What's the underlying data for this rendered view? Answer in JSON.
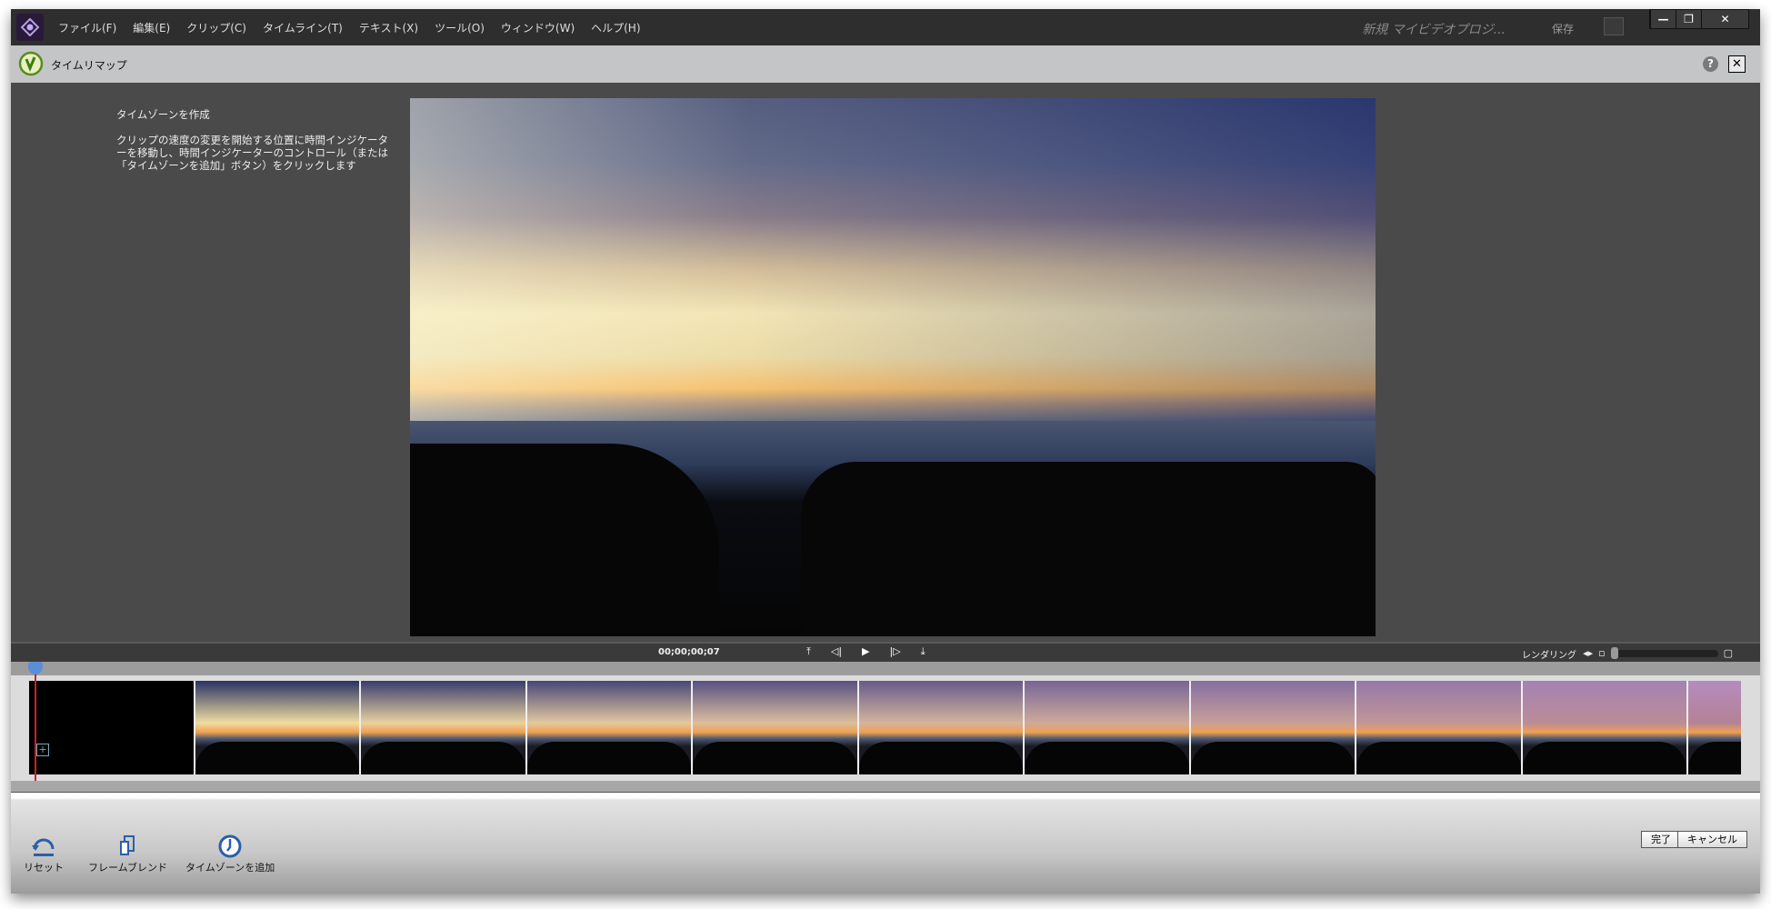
{
  "menu": [
    "ファイル(F)",
    "編集(E)",
    "クリップ(C)",
    "タイムライン(T)",
    "テキスト(X)",
    "ツール(O)",
    "ウィンドウ(W)",
    "ヘルプ(H)"
  ],
  "project_title": "新規 マイビデオプロジ...",
  "save_label": "保存",
  "window_controls": {
    "minimize": "—",
    "restore": "❐",
    "close": "✕"
  },
  "panel": {
    "title": "タイムリマップ",
    "help": "?",
    "close": "✕"
  },
  "instructions": {
    "heading": "タイムゾーンを作成",
    "body": "クリップの速度の変更を開始する位置に時間インジケーターを移動し、時間インジケーターのコントロール（または「タイムゾーンを追加」ボタン）をクリックします"
  },
  "transport": {
    "timecode": "00;00;00;07",
    "buttons": [
      "⤒",
      "◁|",
      "▶",
      "|▷",
      "⤓"
    ]
  },
  "rendering_label": "レンダリング",
  "zoom_level": 0,
  "thumbnail_count": 11,
  "tools": [
    {
      "label": "リセット",
      "icon": "reset-icon"
    },
    {
      "label": "フレームブレンド",
      "icon": "frame-blend-icon"
    },
    {
      "label": "タイムゾーンを追加",
      "icon": "add-timezone-icon"
    }
  ],
  "done_label": "完了",
  "cancel_label": "キャンセル",
  "colors": {
    "accent": "#5a8fd8",
    "playhead": "#cc2222",
    "panel_bg": "#4a4a4a"
  }
}
